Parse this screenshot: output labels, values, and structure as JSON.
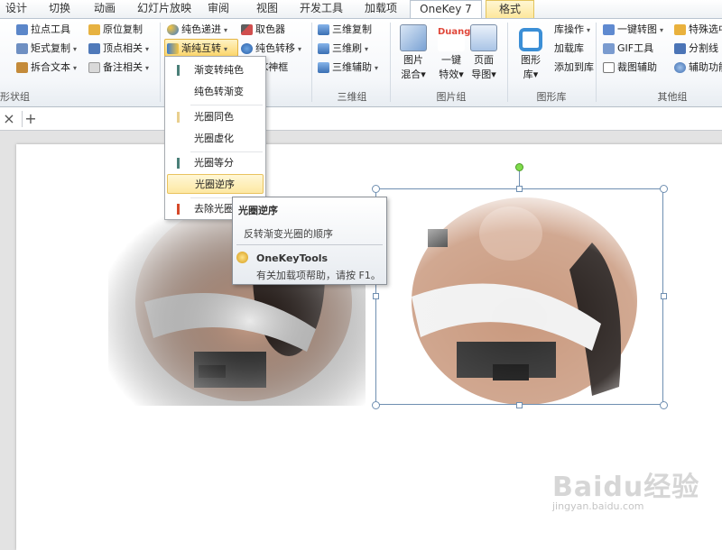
{
  "tabs": [
    "设计",
    "切换",
    "动画",
    "幻灯片放映",
    "审阅",
    "视图",
    "开发工具",
    "加载项",
    "OneKey 7",
    "格式"
  ],
  "active_tab": "OneKey 7",
  "ribbon": {
    "groups": {
      "shape": {
        "label": "形状组",
        "items": [
          "拉点工具",
          "矩式复制",
          "拆合文本",
          "原位复制",
          "顶点相关",
          "备注相关"
        ]
      },
      "color": {
        "items": [
          "纯色递进",
          "渐纯互转",
          "取色器",
          "纯色转移",
          "K神框"
        ]
      },
      "three_d": {
        "label": "三维组",
        "items": [
          "三维复制",
          "三维刷",
          "三维辅助"
        ]
      },
      "picture": {
        "label": "图片组",
        "big_buttons": [
          {
            "line1": "图片",
            "line2": "混合"
          },
          {
            "badge": "Duang",
            "line1": "一键",
            "line2": "特效"
          },
          {
            "line1": "页面",
            "line2": "导图"
          }
        ]
      },
      "library": {
        "label": "图形库",
        "big_button": {
          "line1": "图形",
          "line2": "库"
        },
        "items": [
          "库操作",
          "加载库",
          "添加到库"
        ]
      },
      "other": {
        "label": "其他组",
        "items": [
          "一键转图",
          "GIF工具",
          "裁图辅助",
          "特殊选中",
          "分割线",
          "辅助功能"
        ]
      }
    }
  },
  "docbar": {
    "close": "×",
    "add": "+"
  },
  "dropdown_menu": {
    "items": [
      {
        "label": "渐变转纯色",
        "color": "#4a7f78"
      },
      {
        "label": "纯色转渐变",
        "color": ""
      },
      {
        "label": "光圈同色",
        "color": "#e9cf8e"
      },
      {
        "label": "光圈虚化",
        "color": ""
      },
      {
        "label": "光圈等分",
        "color": "#4a7f78"
      },
      {
        "label": "光圈逆序",
        "color": ""
      },
      {
        "label": "去除光圈",
        "color": "#d64a2a"
      }
    ],
    "highlighted": "光圈逆序"
  },
  "tooltip": {
    "title": "光圈逆序",
    "description": "反转渐变光圈的顺序",
    "help_title": "OneKeyTools",
    "help_text": "有关加载项帮助，请按 F1。"
  },
  "watermark": {
    "brand": "Baidu经验",
    "url": "jingyan.baidu.com"
  },
  "colors": {
    "accent_yellow": "#fcd66c",
    "selection_frame": "#6f8fb1",
    "rotation_handle": "#7fdc4b"
  }
}
